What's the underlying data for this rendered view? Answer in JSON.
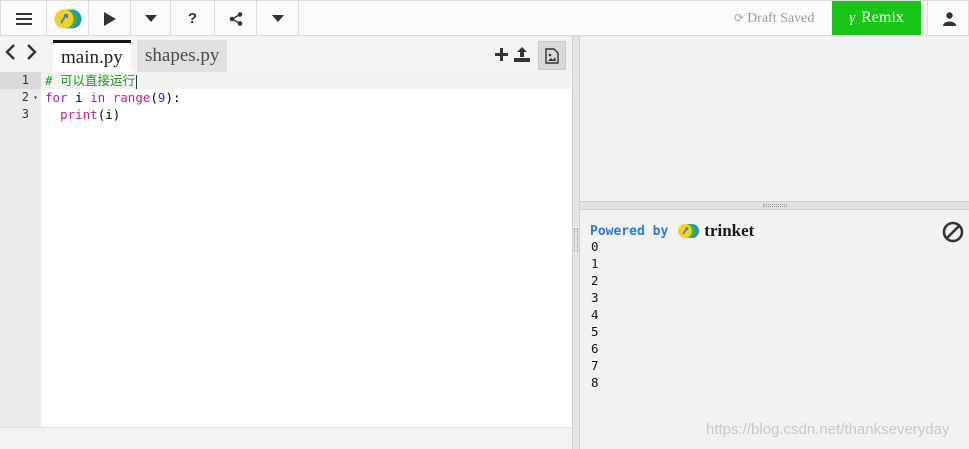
{
  "toolbar": {
    "menu_icon": "hamburger-menu-icon",
    "logo_icon": "trinket-logo-icon",
    "run_icon": "play-icon",
    "run_more_icon": "caret-down-icon",
    "help_label": "?",
    "share_icon": "share-icon",
    "share_more_icon": "caret-down-icon",
    "draft_status": "Draft Saved",
    "remix_label": "Remix",
    "user_icon": "user-icon"
  },
  "editor": {
    "tabs": [
      {
        "label": "main.py",
        "active": true
      },
      {
        "label": "shapes.py",
        "active": false
      }
    ],
    "lines": [
      {
        "number": "1",
        "text": "# 可以直接运行"
      },
      {
        "number": "2",
        "text": "for i in range(9):"
      },
      {
        "number": "3",
        "text": "  print(i)"
      }
    ]
  },
  "console": {
    "powered_by": "Powered by",
    "brand": "trinket",
    "output": [
      "0",
      "1",
      "2",
      "3",
      "4",
      "5",
      "6",
      "7",
      "8"
    ]
  },
  "watermark": "https://blog.csdn.net/thankseveryday",
  "colors": {
    "remix_bg": "#19c519",
    "comment": "#1b9c1b",
    "keyword": "#9b1fc6",
    "builtin": "#c81e89",
    "number": "#1f2ee8",
    "powered": "#2a7bd6"
  }
}
